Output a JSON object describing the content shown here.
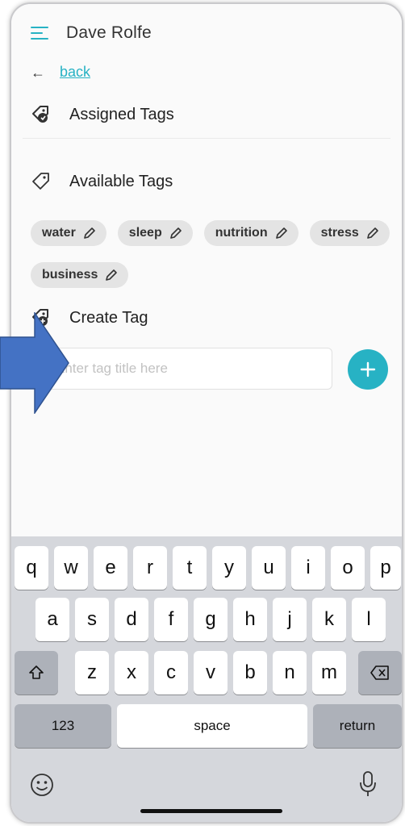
{
  "header": {
    "title": "Dave Rolfe",
    "menu_icon": "hamburger-menu-icon"
  },
  "nav": {
    "back_label": "back",
    "back_icon": "arrow-left-icon"
  },
  "sections": {
    "assigned": {
      "label": "Assigned Tags",
      "icon": "tag-assigned-icon"
    },
    "available": {
      "label": "Available Tags",
      "icon": "tag-outline-icon"
    },
    "create": {
      "label": "Create Tag",
      "icon": "tag-add-icon"
    }
  },
  "tags": [
    "water",
    "sleep",
    "nutrition",
    "stress",
    "business"
  ],
  "create_input": {
    "placeholder": "Enter tag title here",
    "value": ""
  },
  "add_button": {
    "icon": "plus-icon"
  },
  "keyboard": {
    "row1": [
      "q",
      "w",
      "e",
      "r",
      "t",
      "y",
      "u",
      "i",
      "o",
      "p"
    ],
    "row2": [
      "a",
      "s",
      "d",
      "f",
      "g",
      "h",
      "j",
      "k",
      "l"
    ],
    "row3": [
      "z",
      "x",
      "c",
      "v",
      "b",
      "n",
      "m"
    ],
    "numbers_label": "123",
    "space_label": "space",
    "return_label": "return"
  },
  "colors": {
    "accent": "#27b2c4",
    "arrow": "#4472c4",
    "keyboard_bg": "#d5d7dc"
  }
}
